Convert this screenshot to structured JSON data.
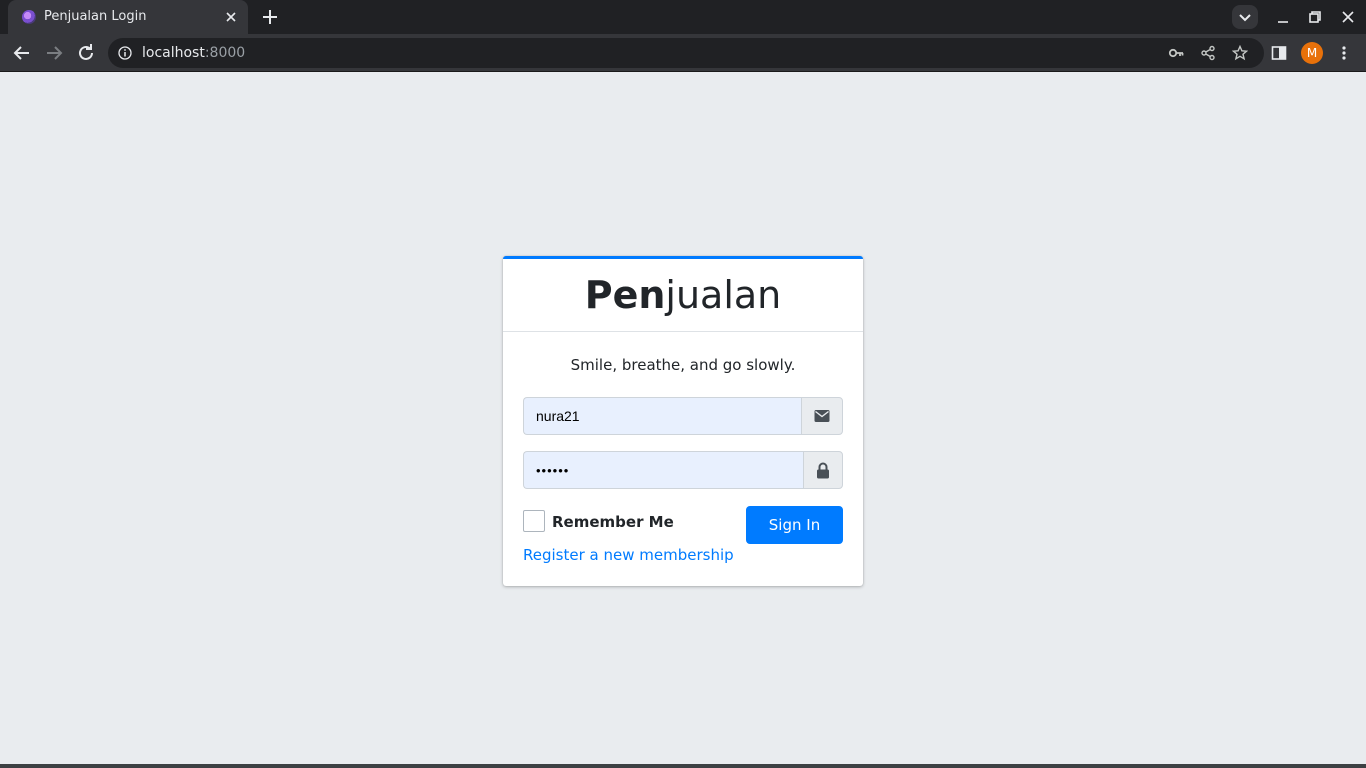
{
  "browser": {
    "tab_title": "Penjualan Login",
    "url_host": "localhost",
    "url_port": ":8000",
    "profile_initial": "M"
  },
  "login": {
    "brand_bold": "Pen",
    "brand_light": "jualan",
    "message": "Smile, breathe, and go slowly.",
    "username_value": "nura21",
    "password_value": "••••••",
    "remember_label": "Remember Me",
    "signin_label": "Sign In",
    "register_label": "Register a new membership"
  },
  "colors": {
    "accent": "#007bff",
    "page_bg": "#e9ecef",
    "autofill_bg": "#e8f0fe"
  }
}
